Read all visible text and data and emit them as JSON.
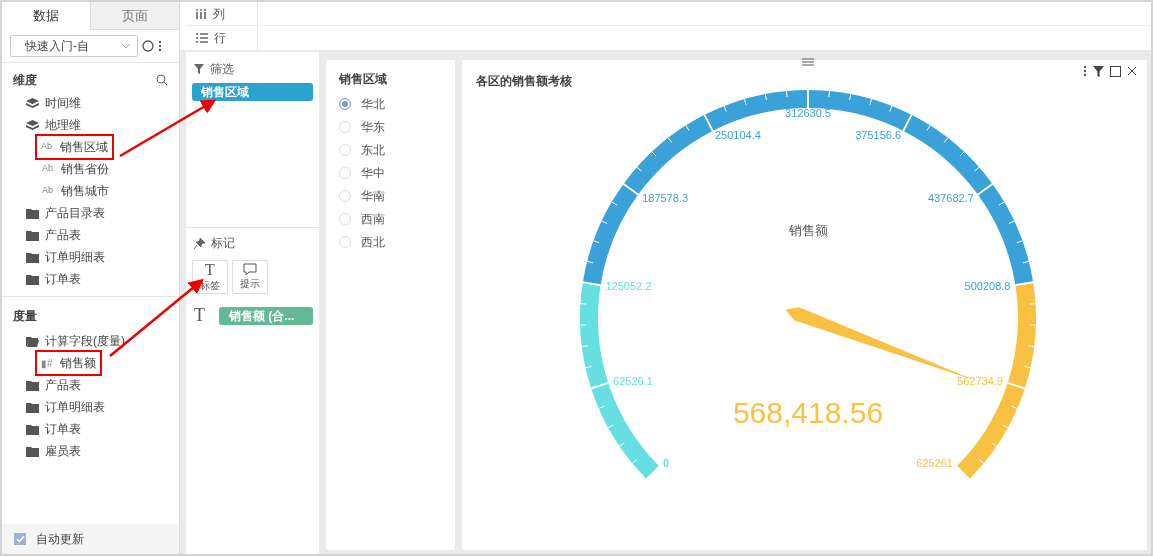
{
  "sidebar": {
    "tabs": [
      {
        "label": "数据",
        "selected": true
      },
      {
        "label": "页面",
        "selected": false
      }
    ],
    "source": "快速入门-自",
    "dimensions": {
      "title": "维度",
      "items": [
        {
          "kind": "layers",
          "label": "时间维",
          "annotated": false
        },
        {
          "kind": "layers",
          "label": "地理维",
          "annotated": false,
          "children": [
            {
              "kind": "text",
              "icon": "Ab",
              "label": "销售区域",
              "annotated": true
            },
            {
              "kind": "text",
              "icon": "Ab",
              "label": "销售省份",
              "annotated": false
            },
            {
              "kind": "text",
              "icon": "Ab",
              "label": "销售城市",
              "annotated": false
            }
          ]
        },
        {
          "kind": "folder",
          "label": "产品目录表",
          "annotated": false
        },
        {
          "kind": "folder",
          "label": "产品表",
          "annotated": false
        },
        {
          "kind": "folder",
          "label": "订单明细表",
          "annotated": false
        },
        {
          "kind": "folder",
          "label": "订单表",
          "annotated": false
        }
      ]
    },
    "measures": {
      "title": "度量",
      "items": [
        {
          "kind": "folder-open",
          "label": "计算字段(度量)",
          "annotated": false,
          "children": [
            {
              "kind": "number",
              "icon": "▮#",
              "label": "销售额",
              "annotated": true
            }
          ]
        },
        {
          "kind": "folder",
          "label": "产品表",
          "annotated": false
        },
        {
          "kind": "folder",
          "label": "订单明细表",
          "annotated": false
        },
        {
          "kind": "folder",
          "label": "订单表",
          "annotated": false
        },
        {
          "kind": "folder",
          "label": "雇员表",
          "annotated": false
        }
      ]
    },
    "auto_update": {
      "label": "自动更新",
      "checked": true
    }
  },
  "shelves": [
    {
      "kind": "columns",
      "label": "列"
    },
    {
      "kind": "rows",
      "label": "行"
    }
  ],
  "filter_panel": {
    "title": "筛选",
    "pill": "销售区域"
  },
  "marks_panel": {
    "title": "标记",
    "buttons": [
      {
        "kind": "text",
        "icon": "T",
        "label": "标签"
      },
      {
        "kind": "tooltip",
        "label": "提示"
      }
    ],
    "field_icon": "T",
    "field": "销售额 (合..."
  },
  "region_filter": {
    "title": "销售区域",
    "options": [
      {
        "label": "华北",
        "selected": true
      },
      {
        "label": "华东",
        "selected": false
      },
      {
        "label": "东北",
        "selected": false
      },
      {
        "label": "华中",
        "selected": false
      },
      {
        "label": "华南",
        "selected": false
      },
      {
        "label": "西南",
        "selected": false
      },
      {
        "label": "西北",
        "selected": false
      }
    ]
  },
  "chart": {
    "title": "各区的销售额考核",
    "gauge": {
      "name": "销售额",
      "value_text": "568,418.56",
      "tick_labels": [
        {
          "label": "0",
          "color": "#66dfe2"
        },
        {
          "label": "62526.1",
          "color": "#66dfe2"
        },
        {
          "label": "125052.2",
          "color": "#66dfe2"
        },
        {
          "label": "187578.3",
          "color": "#3aa1d9"
        },
        {
          "label": "250104.4",
          "color": "#3aa1d9"
        },
        {
          "label": "312630.5",
          "color": "#3aa1d9"
        },
        {
          "label": "375156.6",
          "color": "#3aa1d9"
        },
        {
          "label": "437682.7",
          "color": "#3aa1d9"
        },
        {
          "label": "500208.8",
          "color": "#3aa1d9"
        },
        {
          "label": "562734.9",
          "color": "#f8c141"
        },
        {
          "label": "625261",
          "color": "#f8c141"
        }
      ]
    }
  }
}
